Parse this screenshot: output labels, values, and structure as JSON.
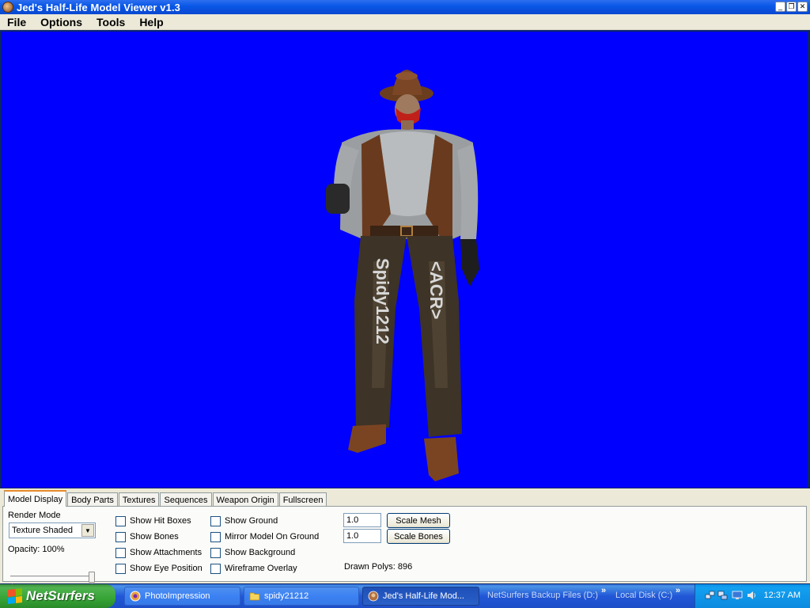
{
  "window": {
    "title": "Jed's Half-Life Model Viewer v1.3",
    "controls": [
      "minimize",
      "restore",
      "close"
    ]
  },
  "menu": [
    "File",
    "Options",
    "Tools",
    "Help"
  ],
  "viewport": {
    "background_color": "#0000ff",
    "model_text_left": "Spidy1212",
    "model_text_right": "<ACR>"
  },
  "tabs": [
    "Model Display",
    "Body Parts",
    "Textures",
    "Sequences",
    "Weapon Origin",
    "Fullscreen"
  ],
  "active_tab": "Model Display",
  "model_display": {
    "render_mode_label": "Render Mode",
    "render_mode_value": "Texture Shaded",
    "opacity_label": "Opacity: 100%",
    "opacity_value": 1.0,
    "checkboxes_col1": [
      "Show Hit Boxes",
      "Show Bones",
      "Show Attachments",
      "Show Eye Position"
    ],
    "checkboxes_col2": [
      "Show Ground",
      "Mirror Model On Ground",
      "Show Background",
      "Wireframe Overlay"
    ],
    "scale_mesh_value": "1.0",
    "scale_bones_value": "1.0",
    "scale_mesh_button": "Scale Mesh",
    "scale_bones_button": "Scale Bones",
    "drawn_polys": "Drawn Polys: 896"
  },
  "taskbar": {
    "start_label": "NetSurfers",
    "tasks": [
      "PhotoImpression",
      "spidy21212",
      "Jed's Half-Life Mod..."
    ],
    "active_task": "Jed's Half-Life Mod...",
    "quick_links": [
      "NetSurfers Backup Files (D:)",
      "Local Disk (C:)"
    ],
    "clock": "12:37 AM"
  },
  "colors": {
    "titlebar": "#0a58e8",
    "viewport": "#0000ff",
    "panel": "#ece9d8",
    "start_button": "#36a436",
    "tray": "#0c8fe6"
  }
}
